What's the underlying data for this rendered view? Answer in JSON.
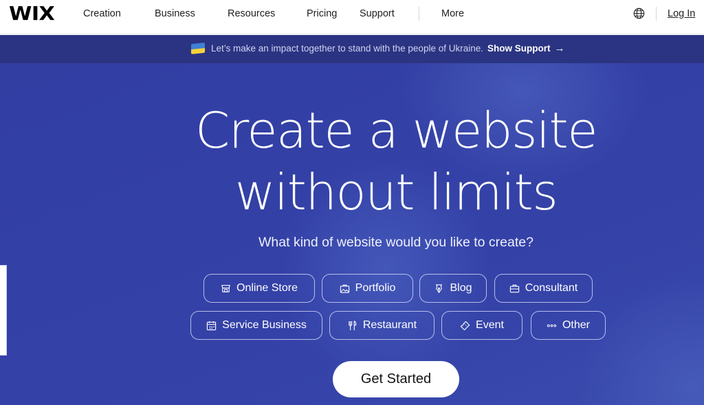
{
  "header": {
    "logo": "WIX",
    "nav": [
      "Creation",
      "Business",
      "Resources",
      "Pricing",
      "Support",
      "More"
    ],
    "globe_icon": "globe-icon",
    "login_label": "Log In"
  },
  "banner": {
    "flag_icon": "ukraine-flag-icon",
    "text": "Let’s make an impact together to stand with the people of Ukraine.",
    "link_label": "Show Support",
    "arrow": "→"
  },
  "hero": {
    "headline_line1": "Create a website",
    "headline_line2": "without limits",
    "subtitle": "What kind of website would you like to create?",
    "categories": [
      {
        "label": "Online Store",
        "icon": "store-icon"
      },
      {
        "label": "Portfolio",
        "icon": "portfolio-icon"
      },
      {
        "label": "Blog",
        "icon": "pen-nib-icon"
      },
      {
        "label": "Consultant",
        "icon": "briefcase-icon"
      },
      {
        "label": "Service Business",
        "icon": "calendar-icon"
      },
      {
        "label": "Restaurant",
        "icon": "utensils-icon"
      },
      {
        "label": "Event",
        "icon": "ticket-icon"
      },
      {
        "label": "Other",
        "icon": "more-dots-icon"
      }
    ],
    "cta_label": "Get Started"
  },
  "colors": {
    "banner_bg": "#2b3482",
    "hero_bg": "#3340a6",
    "text_on_hero": "#ffffff"
  }
}
